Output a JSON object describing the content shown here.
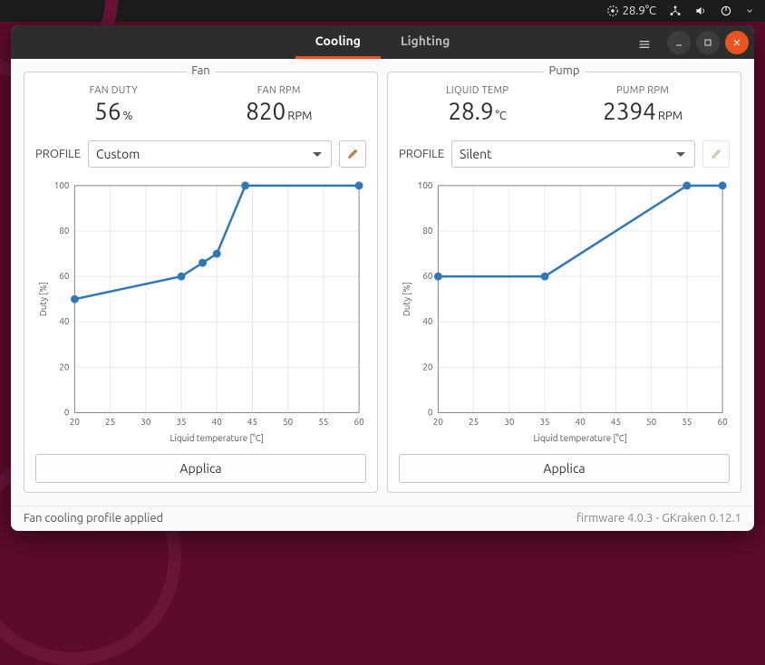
{
  "menubar": {
    "temp": "28.9°C"
  },
  "tabs": {
    "cooling": "Cooling",
    "lighting": "Lighting"
  },
  "fan": {
    "title": "Fan",
    "duty_label": "FAN DUTY",
    "duty_value": "56",
    "duty_unit": "%",
    "rpm_label": "FAN RPM",
    "rpm_value": "820",
    "rpm_unit": "RPM",
    "profile_label": "PROFILE",
    "profile_value": "Custom",
    "apply": "Applica"
  },
  "pump": {
    "title": "Pump",
    "temp_label": "LIQUID TEMP",
    "temp_value": "28.9",
    "temp_unit": "°C",
    "rpm_label": "PUMP RPM",
    "rpm_value": "2394",
    "rpm_unit": "RPM",
    "profile_label": "PROFILE",
    "profile_value": "Silent",
    "apply": "Applica"
  },
  "status": {
    "message": "Fan cooling profile applied",
    "footer": "firmware 4.0.3 - GKraken 0.12.1"
  },
  "chart_data": [
    {
      "type": "line",
      "owner": "fan",
      "xlabel": "Liquid temperature [°C]",
      "ylabel": "Duty [%]",
      "xlim": [
        20,
        60
      ],
      "ylim": [
        0,
        100
      ],
      "xticks": [
        20,
        25,
        30,
        35,
        40,
        45,
        50,
        55,
        60
      ],
      "yticks": [
        0,
        20,
        40,
        60,
        80,
        100
      ],
      "points": [
        {
          "x": 20,
          "y": 50
        },
        {
          "x": 35,
          "y": 60
        },
        {
          "x": 38,
          "y": 66
        },
        {
          "x": 40,
          "y": 70
        },
        {
          "x": 44,
          "y": 100
        },
        {
          "x": 60,
          "y": 100
        }
      ]
    },
    {
      "type": "line",
      "owner": "pump",
      "xlabel": "Liquid temperature [°C]",
      "ylabel": "Duty [%]",
      "xlim": [
        20,
        60
      ],
      "ylim": [
        0,
        100
      ],
      "xticks": [
        20,
        25,
        30,
        35,
        40,
        45,
        50,
        55,
        60
      ],
      "yticks": [
        0,
        20,
        40,
        60,
        80,
        100
      ],
      "points": [
        {
          "x": 20,
          "y": 60
        },
        {
          "x": 35,
          "y": 60
        },
        {
          "x": 55,
          "y": 100
        },
        {
          "x": 60,
          "y": 100
        }
      ]
    }
  ]
}
